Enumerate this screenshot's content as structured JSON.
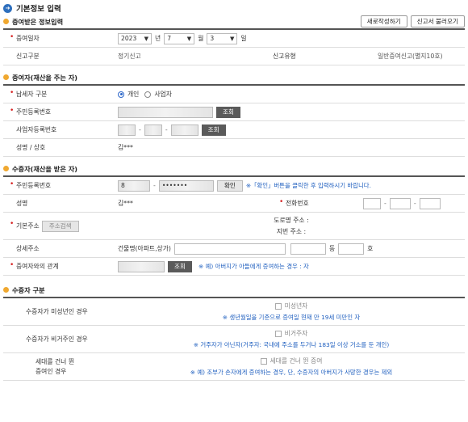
{
  "page_title": "기본정보 입력",
  "gift_info": {
    "heading": "증여받은 정보입력",
    "new_button": "새로작성하기",
    "load_button": "신고서 불러오기",
    "gift_date_label": "증여일자",
    "year": "2023",
    "year_unit": "년",
    "month": "7",
    "month_unit": "월",
    "day": "3",
    "day_unit": "일",
    "report_type_label": "신고구분",
    "report_type_value": "정기신고",
    "report_kind_label": "신고유형",
    "report_kind_value": "일반증여신고(별지10호)"
  },
  "giver": {
    "heading": "증여자(재산을 주는 자)",
    "taxpayer_type_label": "납세자 구분",
    "option_individual": "개인",
    "option_business": "사업자",
    "rrn_label": "주민등록번호",
    "lookup_button": "조회",
    "brn_label": "사업자등록번호",
    "brn_lookup_button": "조회",
    "name_label": "성명 / 상호",
    "name_value": "김***"
  },
  "receiver": {
    "heading": "수증자(재산을 받은 자)",
    "rrn_label": "주민등록번호",
    "rrn_front": "8",
    "rrn_back": "•••••••",
    "confirm_button": "확인",
    "confirm_note": "※「확인」버튼을 클릭한 후 입력하시기 바랍니다.",
    "name_label": "성명",
    "name_value": "김***",
    "phone_label": "전화번호",
    "address_label": "기본주소",
    "address_search_button": "주소검색",
    "road_address": "도로명 주소 :",
    "lot_address": "지번 주소 :",
    "detail_label": "상세주소",
    "building_label": "건물명(아파트,상가)",
    "dong_unit": "동",
    "ho_unit": "호",
    "relation_label": "증여자와의 관계",
    "relation_lookup_button": "조회",
    "relation_note": "※ 예) 아버지가 아들에게 증여하는 경우 : 자"
  },
  "receiver_type": {
    "heading": "수증자 구분",
    "minor_label": "수증자가 미성년인 경우",
    "minor_check": "미성년자",
    "minor_note": "※ 생년월일을 기준으로 증여일 현재 만 19세 미만인 자",
    "nonresident_label": "수증자가 비거주인 경우",
    "nonresident_check": "비거주자",
    "nonresident_note": "※ 거주자가 아닌자(거주자: 국내에 주소를 두거나 183일 이상 거소를 둔 개인)",
    "skip_label_1": "세대를 건너 뛴",
    "skip_label_2": "증여인 경우",
    "skip_check": "세대를 건너 뛴 증여",
    "skip_note": "※ 예) 조부가 손자에게 증여하는 경우, 단, 수증자의 아버지가 사망한 경우는 제외"
  }
}
